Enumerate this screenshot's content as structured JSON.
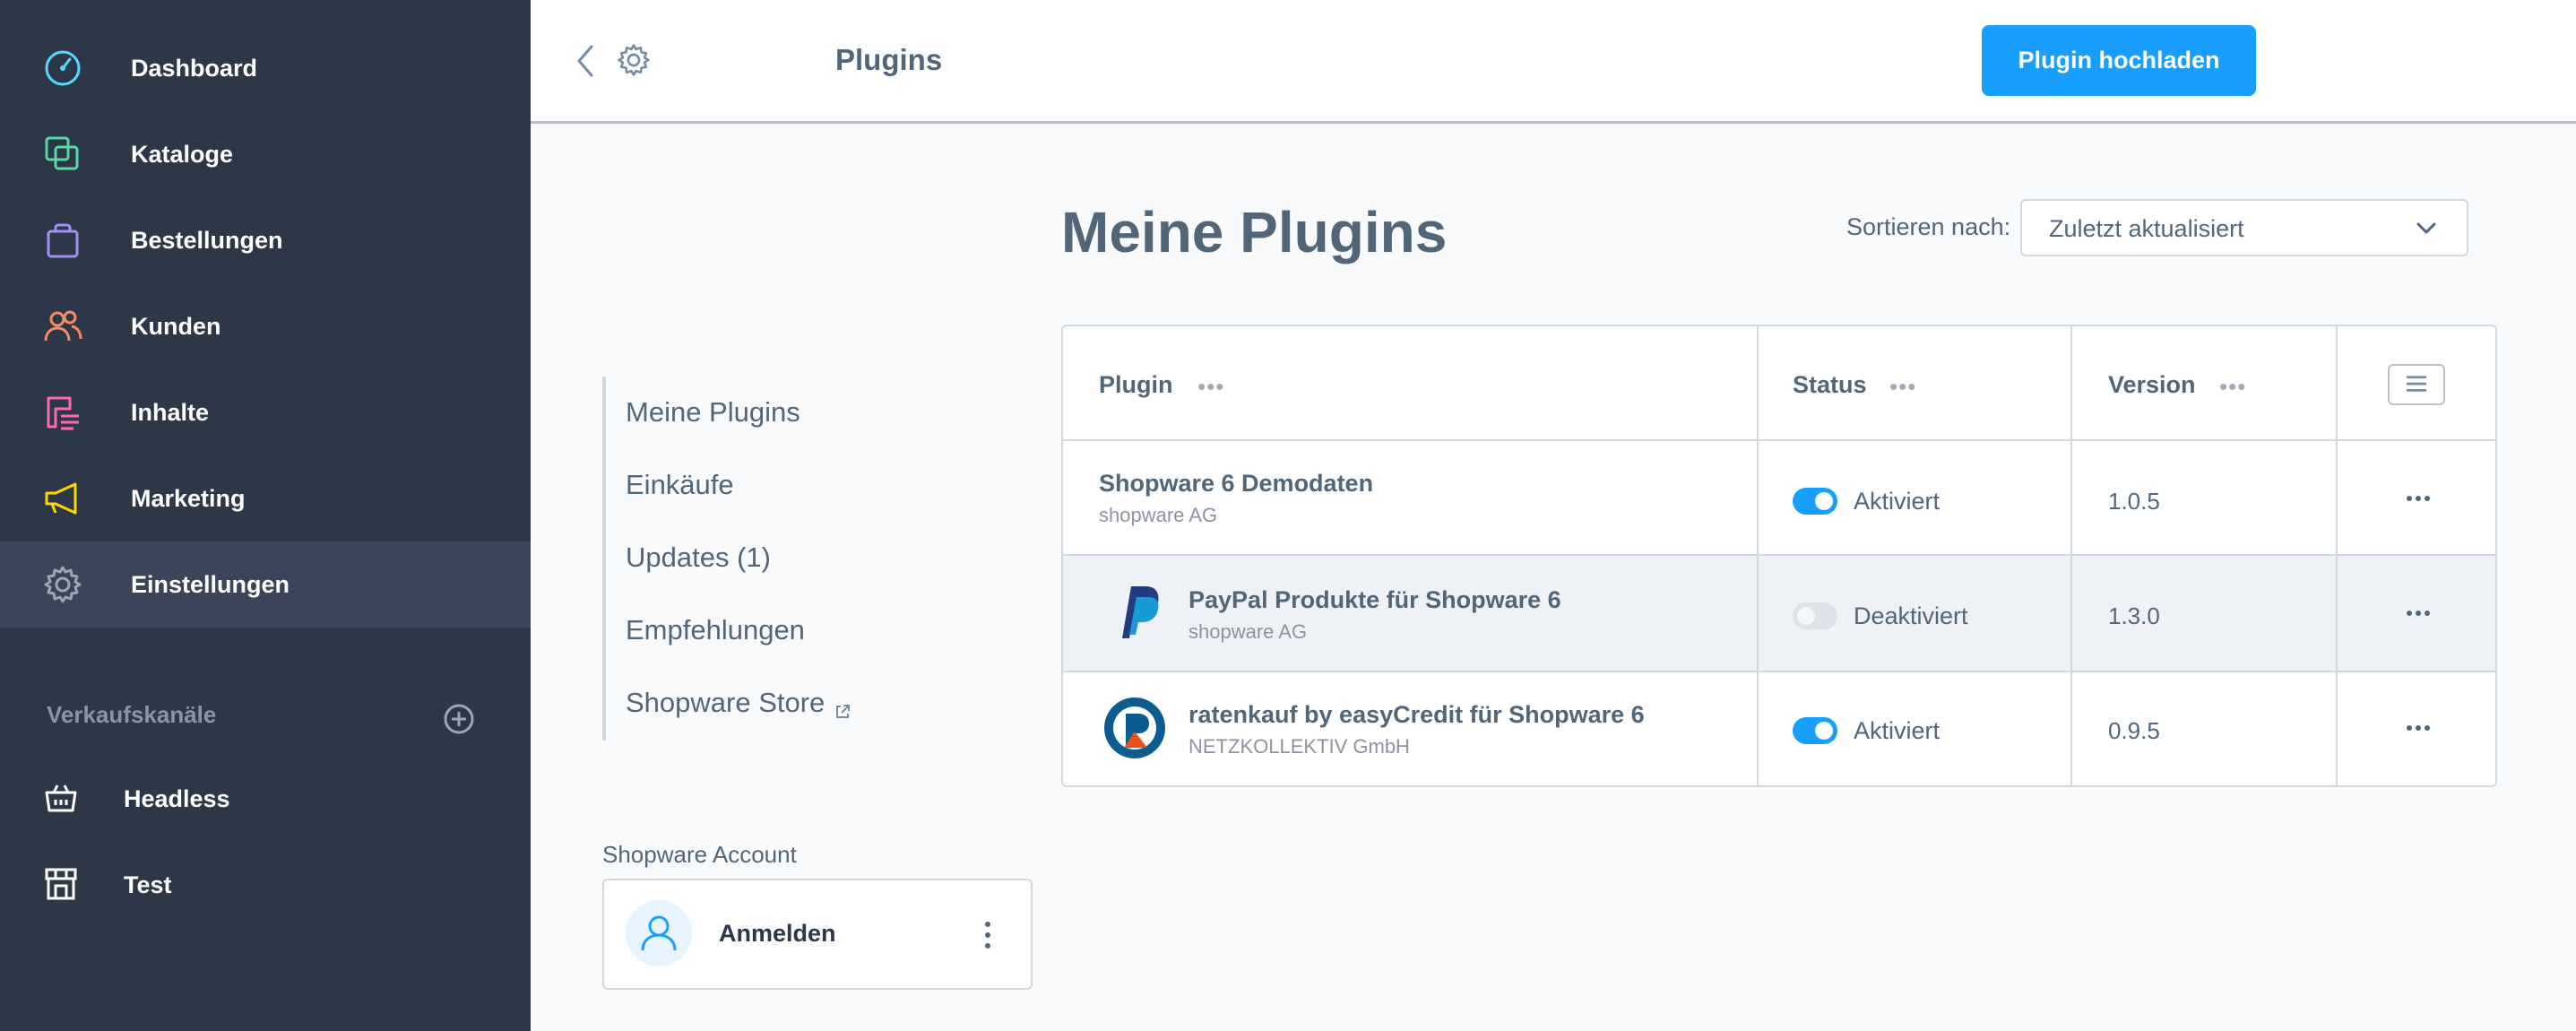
{
  "sidebar": {
    "items": [
      {
        "label": "Dashboard",
        "icon": "dashboard-icon",
        "color": "#57d9ff"
      },
      {
        "label": "Kataloge",
        "icon": "catalog-icon",
        "color": "#57d9a3"
      },
      {
        "label": "Bestellungen",
        "icon": "orders-bag-icon",
        "color": "#a092f0"
      },
      {
        "label": "Kunden",
        "icon": "customers-icon",
        "color": "#f88962"
      },
      {
        "label": "Inhalte",
        "icon": "content-icon",
        "color": "#ff68b4"
      },
      {
        "label": "Marketing",
        "icon": "marketing-megaphone-icon",
        "color": "#ffd700"
      },
      {
        "label": "Einstellungen",
        "icon": "settings-gear-icon",
        "color": "#9aa8b5"
      }
    ],
    "sales_channels": {
      "heading": "Verkaufskanäle",
      "items": [
        {
          "label": "Headless",
          "icon": "basket-icon"
        },
        {
          "label": "Test",
          "icon": "storefront-icon"
        }
      ]
    }
  },
  "topbar": {
    "title": "Plugins",
    "upload_label": "Plugin hochladen"
  },
  "subnav": {
    "items": [
      "Meine Plugins",
      "Einkäufe",
      "Updates (1)",
      "Empfehlungen",
      "Shopware Store"
    ]
  },
  "account": {
    "label": "Shopware Account",
    "login": "Anmelden"
  },
  "main": {
    "title": "Meine Plugins",
    "sort_label": "Sortieren nach:",
    "sort_value": "Zuletzt aktualisiert"
  },
  "grid": {
    "columns": [
      "Plugin",
      "Status",
      "Version"
    ],
    "rows": [
      {
        "name": "Shopware 6 Demodaten",
        "vendor": "shopware AG",
        "status": "Aktiviert",
        "active": true,
        "version": "1.0.5",
        "logo": ""
      },
      {
        "name": "PayPal Produkte für Shopware 6",
        "vendor": "shopware AG",
        "status": "Deaktiviert",
        "active": false,
        "version": "1.3.0",
        "logo": "paypal-logo-icon"
      },
      {
        "name": "ratenkauf by easyCredit für Shopware 6",
        "vendor": "NETZKOLLEKTIV GmbH",
        "status": "Aktiviert",
        "active": true,
        "version": "0.9.5",
        "logo": "easycredit-logo-icon"
      }
    ]
  },
  "colors": {
    "sidebar_bg": "#2c3748",
    "accent": "#189eff",
    "text": "#52667a"
  }
}
